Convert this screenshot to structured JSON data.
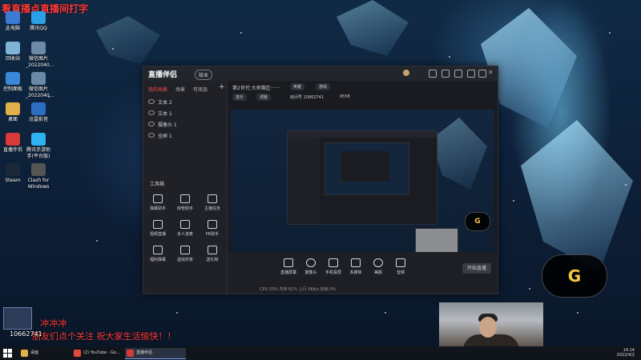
{
  "overlay": {
    "title": "看直播点直播间打字"
  },
  "desktop_icons": [
    {
      "label": "此电脑",
      "color": "#3b7bd6"
    },
    {
      "label": "腾讯QQ",
      "color": "#2aa0e6"
    },
    {
      "label": "回收站",
      "color": "#7fb3d8"
    },
    {
      "label": "微信图片_2022040...",
      "color": "#6a8aa8"
    },
    {
      "label": "控制面板",
      "color": "#3b89d6"
    },
    {
      "label": "微信图片_2022040...",
      "color": "#6a8aa8"
    },
    {
      "label": "桌面",
      "color": "#e2b04a"
    },
    {
      "label": "迅雷影音",
      "color": "#2d6ec2"
    },
    {
      "label": "直播伴侣",
      "color": "#d83a3a"
    },
    {
      "label": "腾讯手游助手(平台版)",
      "color": "#2fb2f0"
    },
    {
      "label": "Steam",
      "color": "#1b2838"
    },
    {
      "label": "Clash for Windows",
      "color": "#555"
    }
  ],
  "app": {
    "logo": "直播伴侣",
    "badge": "版本",
    "tabs": [
      "我的场景",
      "场景",
      "可添加"
    ],
    "scenes": [
      "文本 2",
      "文本 1",
      "摄像头 1",
      "全屏 1"
    ],
    "tools_title": "工具箱",
    "tools": [
      "弹幕助手",
      "房管助手",
      "主播任务",
      "视频直播",
      "多人连麦",
      "PK助手",
      "福利弹幕",
      "虚拟形象",
      "送礼物"
    ],
    "room_title": "第2世代·大师赛区······",
    "pills": [
      "英雄",
      "游戏",
      "音乐",
      "调整"
    ],
    "room_info": "房间号 10662741",
    "viewers": "9558",
    "bottom_items": [
      "直播屏幕",
      "摄像头",
      "手机投屏",
      "多媒体",
      "美颜",
      "音频"
    ],
    "start": "开始直播",
    "status": "CPU 33%  内存 61%  上行 0Kb/s  掉帧 0%"
  },
  "chat": {
    "line1": "冲冲冲",
    "line2": "朋友们点个关注 祝大家生活愉快！！",
    "room_id": "10662741"
  },
  "taskbar": {
    "items": [
      {
        "label": "桌面",
        "color": "#e2b04a"
      },
      {
        "label": "(2) YouTube - Go...",
        "color": "#e44a3a"
      },
      {
        "label": "直播伴侣",
        "color": "#d83a3a"
      }
    ],
    "time": "14:14",
    "date": "2022/4/2"
  }
}
